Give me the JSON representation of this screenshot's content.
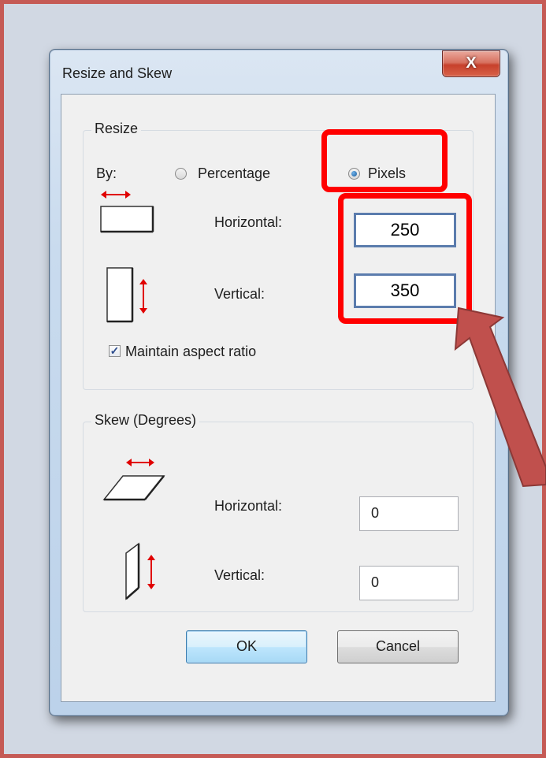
{
  "dialog": {
    "title": "Resize and Skew",
    "close_label": "X"
  },
  "resize": {
    "group_title": "Resize",
    "by_label": "By:",
    "options": [
      {
        "label": "Percentage",
        "selected": false
      },
      {
        "label": "Pixels",
        "selected": true
      }
    ],
    "horizontal_label": "Horizontal:",
    "horizontal_value": "250",
    "vertical_label": "Vertical:",
    "vertical_value": "350",
    "maintain_aspect_ratio": {
      "label": "Maintain aspect ratio",
      "checked": true
    }
  },
  "skew": {
    "group_title": "Skew (Degrees)",
    "horizontal_label": "Horizontal:",
    "horizontal_value": "0",
    "vertical_label": "Vertical:",
    "vertical_value": "0"
  },
  "buttons": {
    "ok": "OK",
    "cancel": "Cancel"
  },
  "annotations": {
    "highlight_color": "#ff0000",
    "arrow_color": "#c0504d"
  },
  "icons": [
    "resize-horizontal-icon",
    "resize-vertical-icon",
    "skew-horizontal-icon",
    "skew-vertical-icon"
  ]
}
